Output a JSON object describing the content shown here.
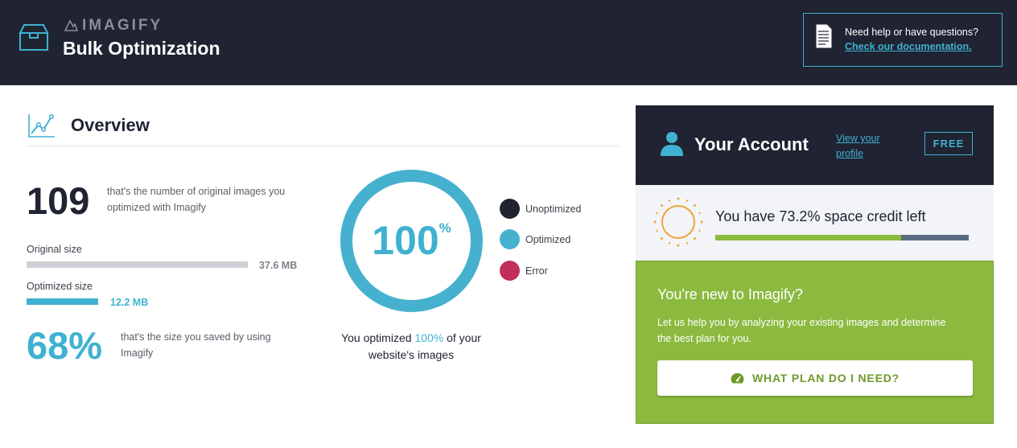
{
  "header": {
    "brand": "IMAGIFY",
    "title": "Bulk Optimization",
    "help_text": "Need help or have questions?",
    "help_link": "Check our documentation."
  },
  "overview": {
    "title": "Overview",
    "count": "109",
    "count_desc": "that's the number of original images you optimized with Imagify",
    "original_label": "Original size",
    "original_value": "37.6 MB",
    "optimized_label": "Optimized size",
    "optimized_value": "12.2 MB",
    "optimized_fraction": 0.324,
    "saved_pct": "68%",
    "saved_desc": "that's the size you saved by using Imagify",
    "donut_value": "100",
    "donut_symbol": "%",
    "donut_fraction": 1.0,
    "caption_pre": "You optimized ",
    "caption_pct": "100%",
    "caption_post": " of your website's images",
    "legend": [
      {
        "label": "Unoptimized",
        "color": "#1f2332"
      },
      {
        "label": "Optimized",
        "color": "#46b1cf"
      },
      {
        "label": "Error",
        "color": "#c0305a"
      }
    ]
  },
  "account": {
    "title": "Your Account",
    "profile_link": "View your profile",
    "plan_badge": "FREE",
    "credit_text": "You have 73.2% space credit left",
    "credit_fraction": 0.732,
    "new_title": "You're new to Imagify?",
    "new_desc": "Let us help you by analyzing your existing images and determine the best plan for you.",
    "plan_button": "WHAT PLAN DO I NEED?"
  },
  "colors": {
    "header_bg": "#1f2332",
    "accent_blue": "#40b1d0",
    "accent_green": "#8bba3f",
    "credit_remaining": "#5a6a82"
  }
}
